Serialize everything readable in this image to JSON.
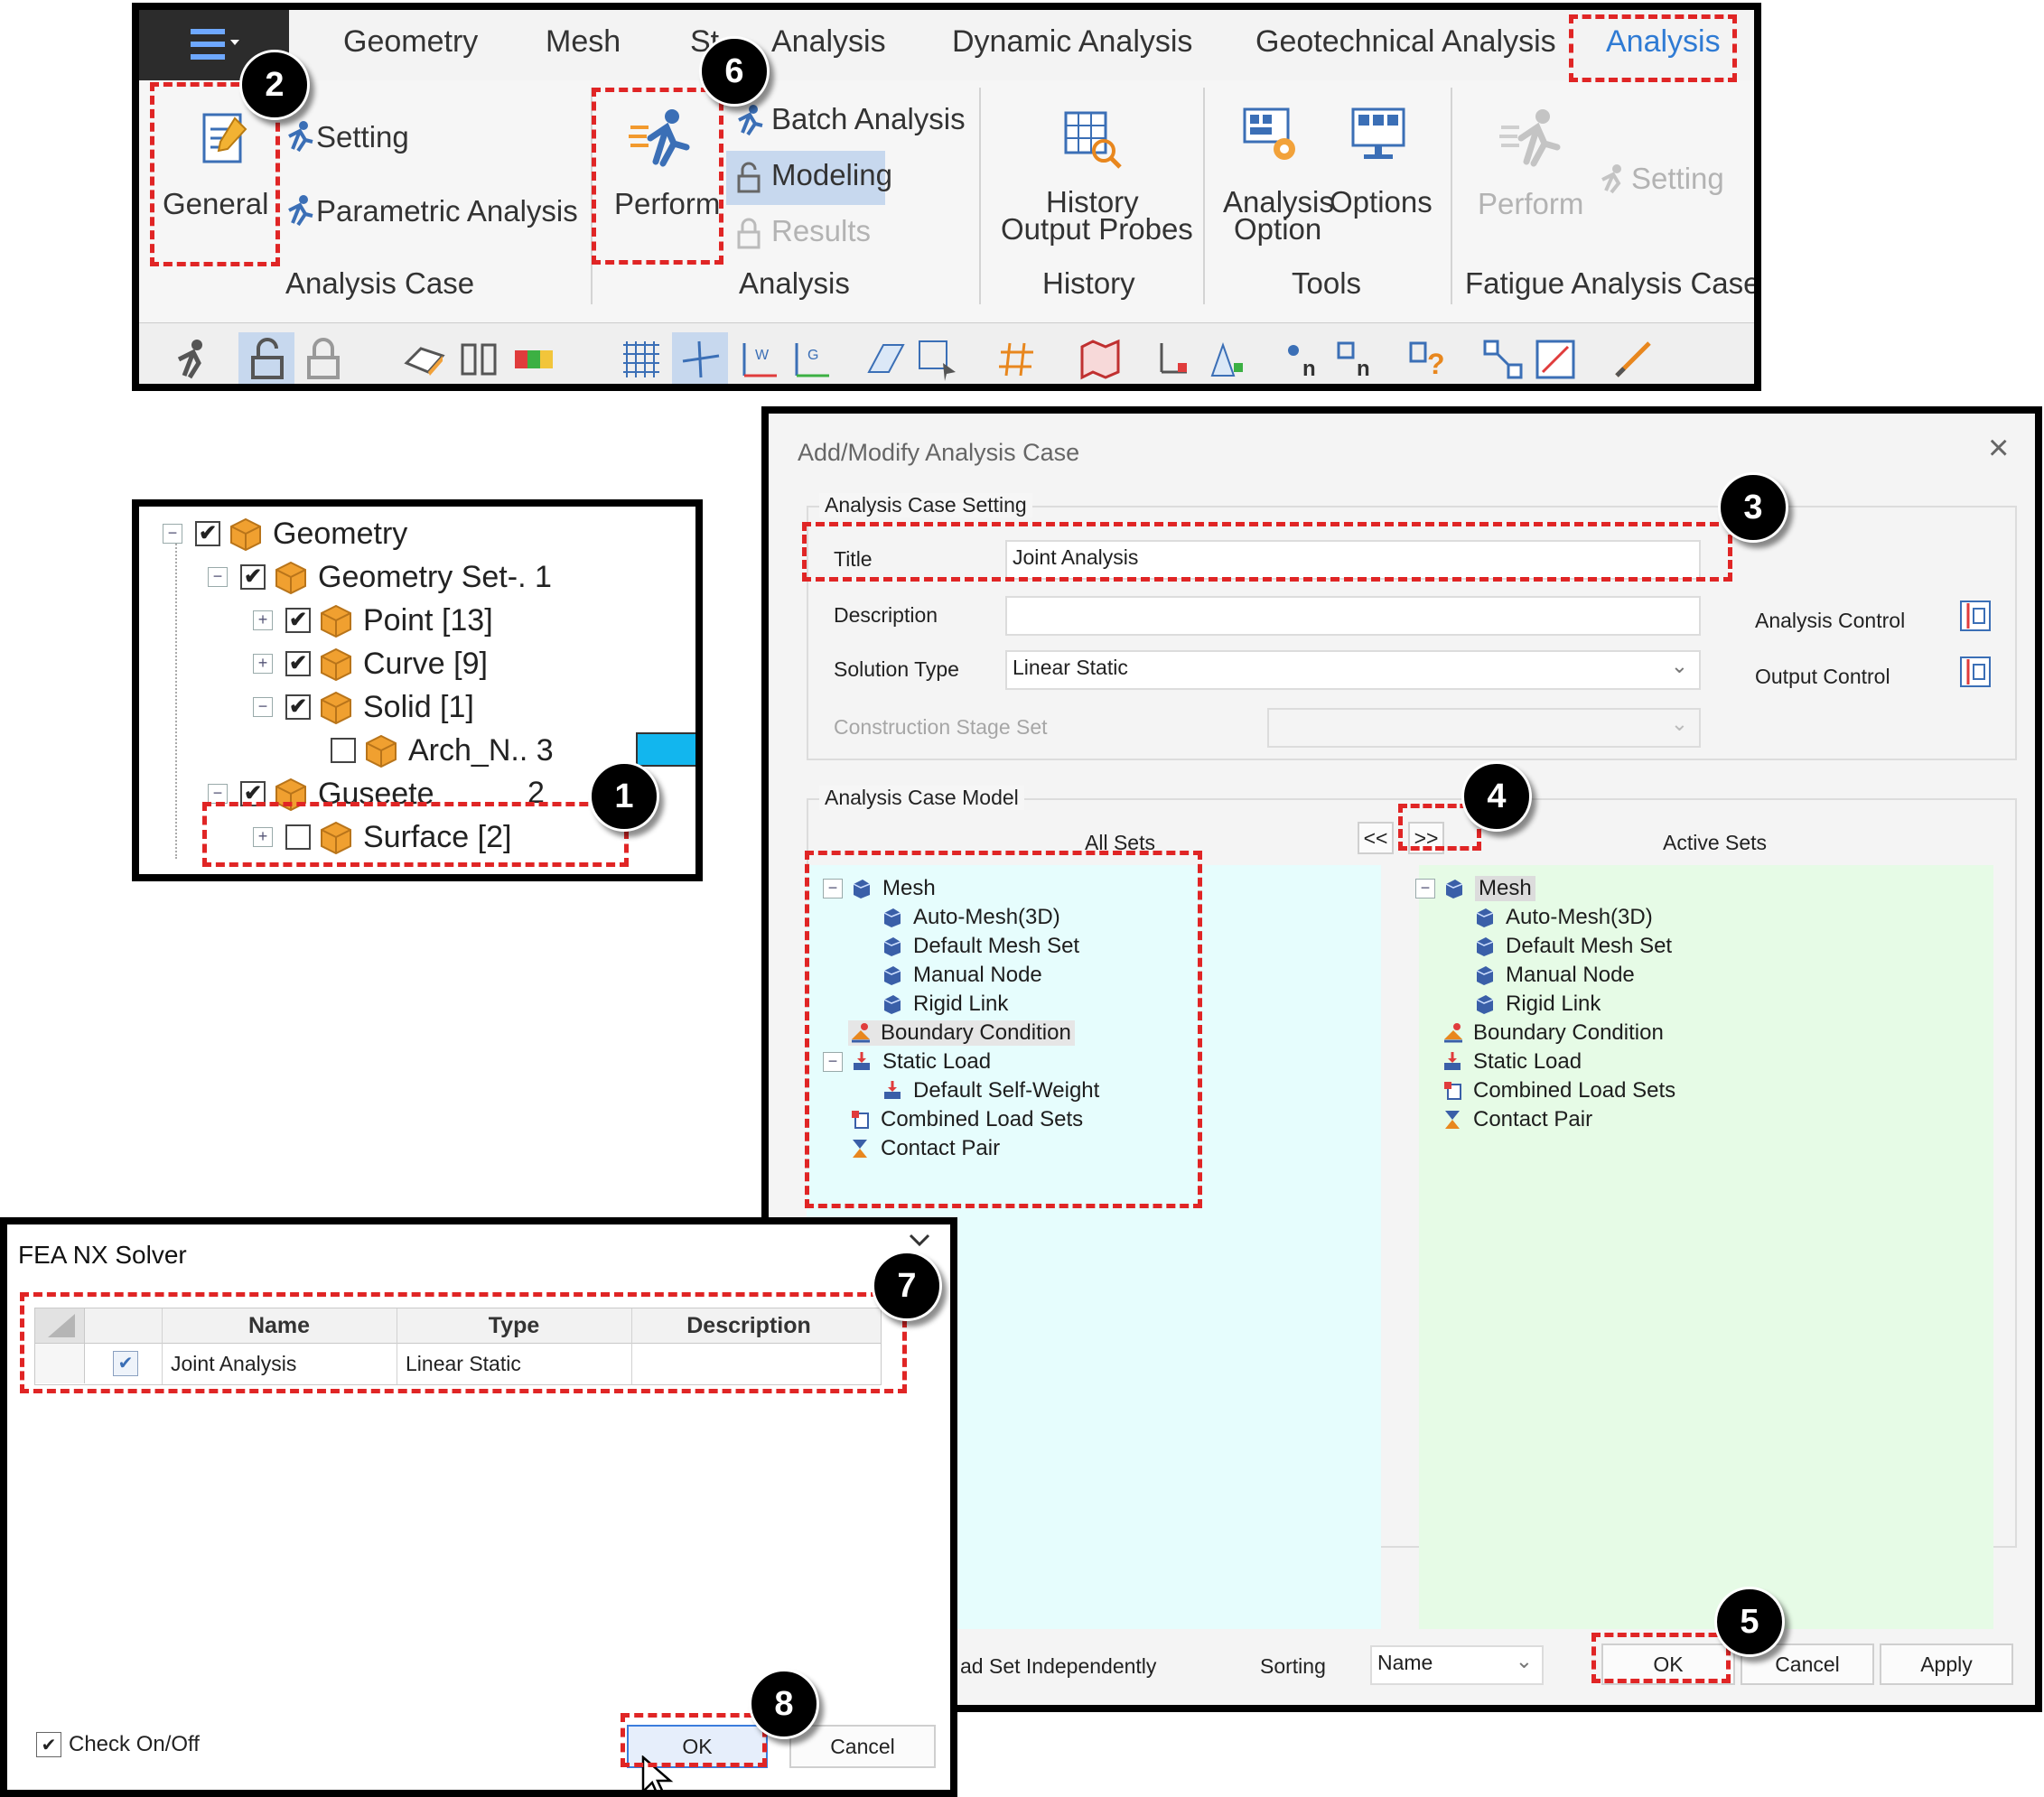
{
  "ribbon": {
    "tabs": [
      "Geometry",
      "Mesh",
      "St",
      "Analysis",
      "Dynamic Analysis",
      "Geotechnical Analysis",
      "Analysis"
    ],
    "active_tab": "Analysis",
    "analysis_case": {
      "general": "General",
      "setting": "Setting",
      "parametric": "Parametric Analysis",
      "group": "Analysis Case"
    },
    "analysis": {
      "perform": "Perform",
      "batch": "Batch Analysis",
      "modeling": "Modeling",
      "results": "Results",
      "group": "Analysis"
    },
    "history": {
      "probes_line1": "History",
      "probes_line2": "Output Probes",
      "group": "History"
    },
    "tools": {
      "analysis_option_1": "Analysis",
      "analysis_option_2": "Option",
      "options": "Options",
      "group": "Tools"
    },
    "fatigue": {
      "perform": "Perform",
      "setting": "Setting",
      "group": "Fatigue Analysis Case"
    }
  },
  "tree": {
    "rows": [
      {
        "label": "Geometry",
        "checked": true
      },
      {
        "label": "Geometry Set-. 1",
        "checked": true
      },
      {
        "label": "Point [13]",
        "checked": true
      },
      {
        "label": "Curve [9]",
        "checked": true
      },
      {
        "label": "Solid [1]",
        "checked": true
      },
      {
        "label": "Arch_N.. 3",
        "checked": false
      },
      {
        "label": "Guseete",
        "count": "2",
        "checked": true
      },
      {
        "label": "Surface [2]",
        "checked": false
      }
    ]
  },
  "dialog": {
    "title": "Add/Modify Analysis Case",
    "setting_legend": "Analysis Case Setting",
    "title_label": "Title",
    "title_value": "Joint Analysis",
    "description_label": "Description",
    "description_value": "",
    "solution_label": "Solution Type",
    "solution_value": "Linear Static",
    "stage_label": "Construction Stage Set",
    "analysis_control": "Analysis Control",
    "output_control": "Output Control",
    "model_legend": "Analysis Case Model",
    "all_sets": "All Sets",
    "active_sets": "Active Sets",
    "move_left": "<<",
    "move_right": ">>",
    "all_items": [
      "Mesh",
      "Auto-Mesh(3D)",
      "Default Mesh Set",
      "Manual Node",
      "Rigid Link",
      "Boundary Condition",
      "Static Load",
      "Default Self-Weight",
      "Combined Load Sets",
      "Contact Pair"
    ],
    "active_items": [
      "Mesh",
      "Auto-Mesh(3D)",
      "Default Mesh Set",
      "Manual Node",
      "Rigid Link",
      "Boundary Condition",
      "Static Load",
      "Combined Load Sets",
      "Contact Pair"
    ],
    "independent": "ad Set Independently",
    "sorting_label": "Sorting",
    "sorting_value": "Name",
    "ok": "OK",
    "cancel": "Cancel",
    "apply": "Apply",
    "close": "×"
  },
  "solver": {
    "title": "FEA NX Solver",
    "columns": [
      "Name",
      "Type",
      "Description"
    ],
    "row": {
      "name": "Joint Analysis",
      "type": "Linear Static",
      "description": "",
      "checked": true
    },
    "check_onoff": "Check On/Off",
    "ok": "OK",
    "cancel": "Cancel"
  },
  "steps": [
    "1",
    "2",
    "3",
    "4",
    "5",
    "6",
    "7",
    "8"
  ],
  "colors": {
    "highlight": "#e02525",
    "accent": "#2f7bd4",
    "all_sets_bg": "#e6fdfd",
    "active_sets_bg": "#e6fbe6",
    "cube": "#f0a030"
  }
}
